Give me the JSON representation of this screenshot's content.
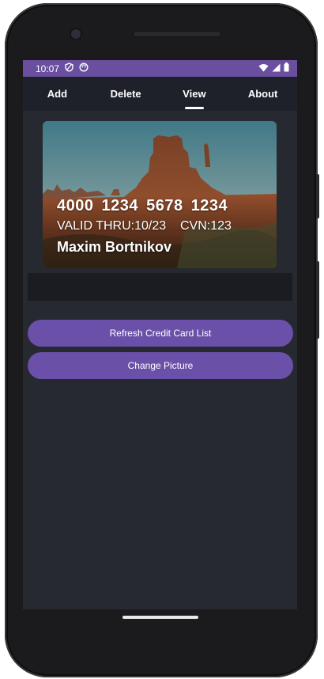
{
  "status_bar": {
    "time": "10:07",
    "icons_left": [
      "shield-icon",
      "face-icon"
    ],
    "icons_right": [
      "wifi-icon",
      "cell-signal-icon",
      "battery-icon"
    ]
  },
  "nav": {
    "tabs": [
      {
        "label": "Add",
        "active": false
      },
      {
        "label": "Delete",
        "active": false
      },
      {
        "label": "View",
        "active": true
      },
      {
        "label": "About",
        "active": false
      }
    ]
  },
  "card": {
    "number": "4000 1234 5678 1234",
    "valid_thru": "VALID THRU:10/23",
    "cvn": "CVN:123",
    "holder": "Maxim Bortnikov"
  },
  "buttons": {
    "refresh_label": "Refresh Credit Card List",
    "change_picture_label": "Change Picture"
  },
  "colors": {
    "status_bar": "#6a4fa0",
    "nav_bg": "#1e2129",
    "screen_bg": "#262930",
    "button": "#6a50a8"
  }
}
